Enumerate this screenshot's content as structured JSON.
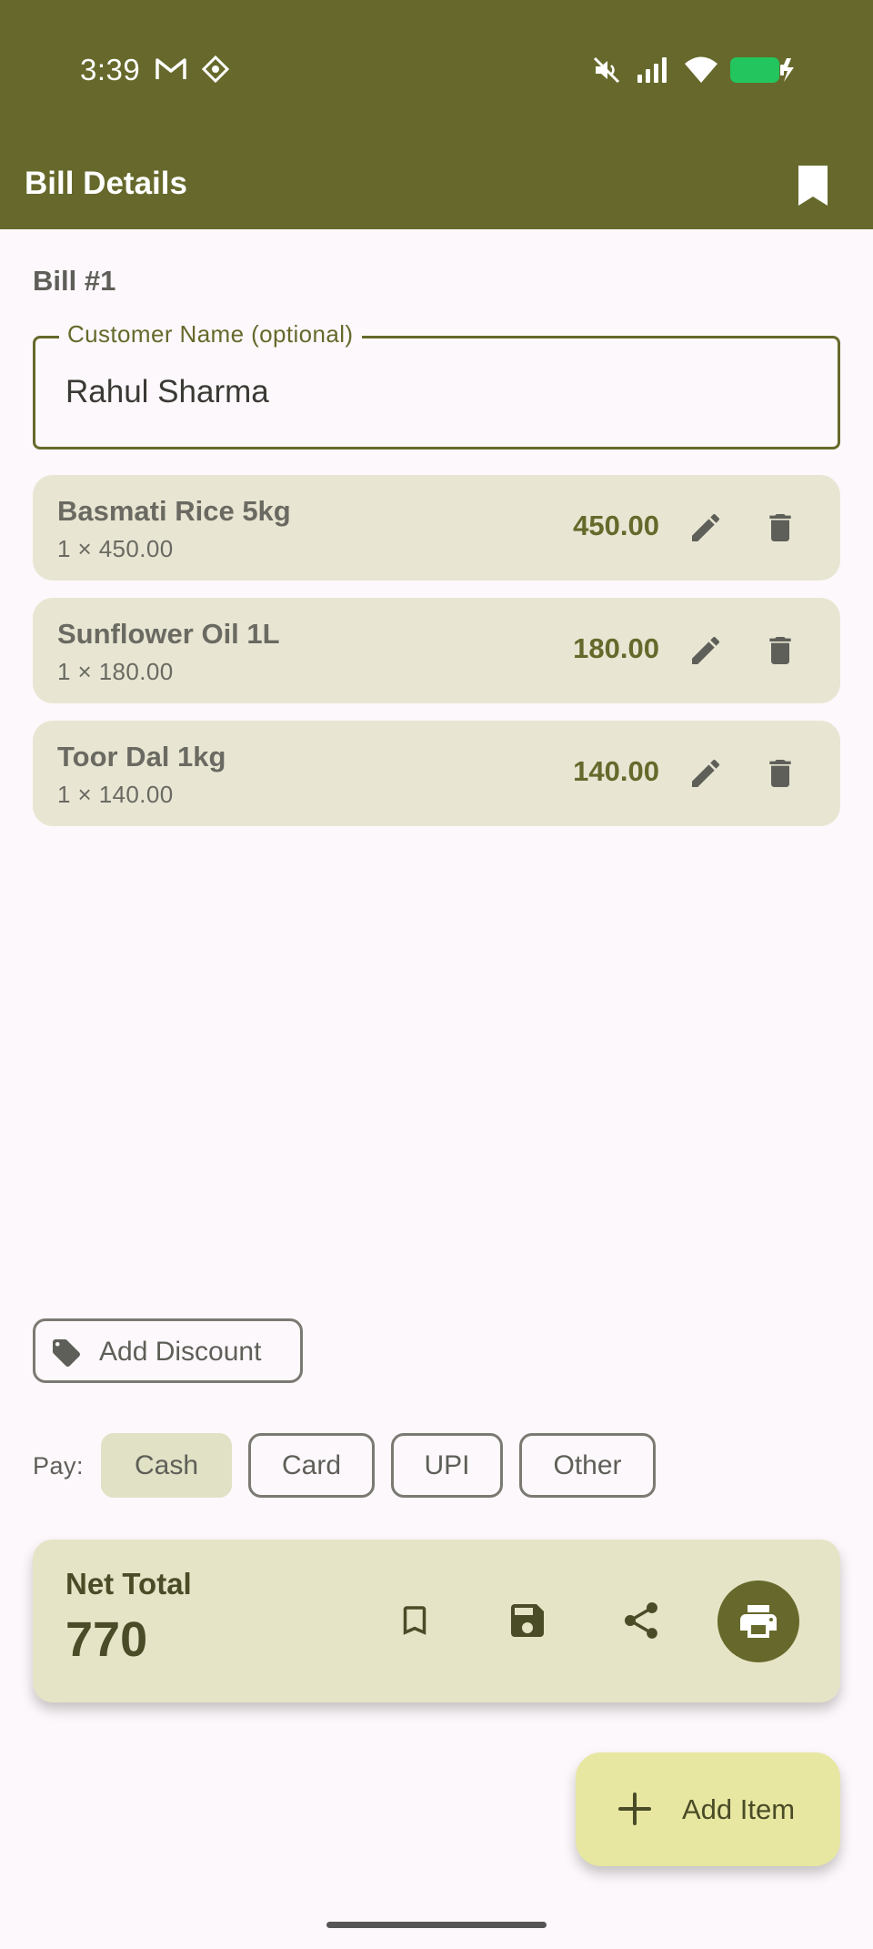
{
  "colors": {
    "primary": "#66692b",
    "item_background": "#e8e6d3",
    "selected_chip": "#e1e1c5",
    "fab_background": "#e7e7a1",
    "battery": "#22c55e"
  },
  "status_bar": {
    "time": "3:39",
    "icons": [
      "gmail-icon",
      "notification-app-icon",
      "mute-icon",
      "signal-icon",
      "wifi-icon",
      "battery-charging-icon"
    ]
  },
  "app_bar": {
    "title": "Bill Details",
    "action_icon": "bookmark-icon"
  },
  "bill": {
    "number": "Bill #1",
    "customer_label": "Customer Name (optional)",
    "customer_value": "Rahul Sharma"
  },
  "items": [
    {
      "name": "Basmati Rice 5kg",
      "detail": "1 × 450.00",
      "price": "450.00"
    },
    {
      "name": "Sunflower Oil 1L",
      "detail": "1 × 180.00",
      "price": "180.00"
    },
    {
      "name": "Toor Dal 1kg",
      "detail": "1 × 140.00",
      "price": "140.00"
    }
  ],
  "discount": {
    "label": "Add Discount",
    "icon": "tag-icon"
  },
  "payment": {
    "label": "Pay:",
    "options": [
      "Cash",
      "Card",
      "UPI",
      "Other"
    ],
    "selected": "Cash"
  },
  "total": {
    "label": "Net Total",
    "value": "770",
    "actions": [
      "bookmark-icon",
      "save-icon",
      "share-icon",
      "print-icon"
    ]
  },
  "fab": {
    "label": "Add Item",
    "icon": "plus-icon"
  }
}
